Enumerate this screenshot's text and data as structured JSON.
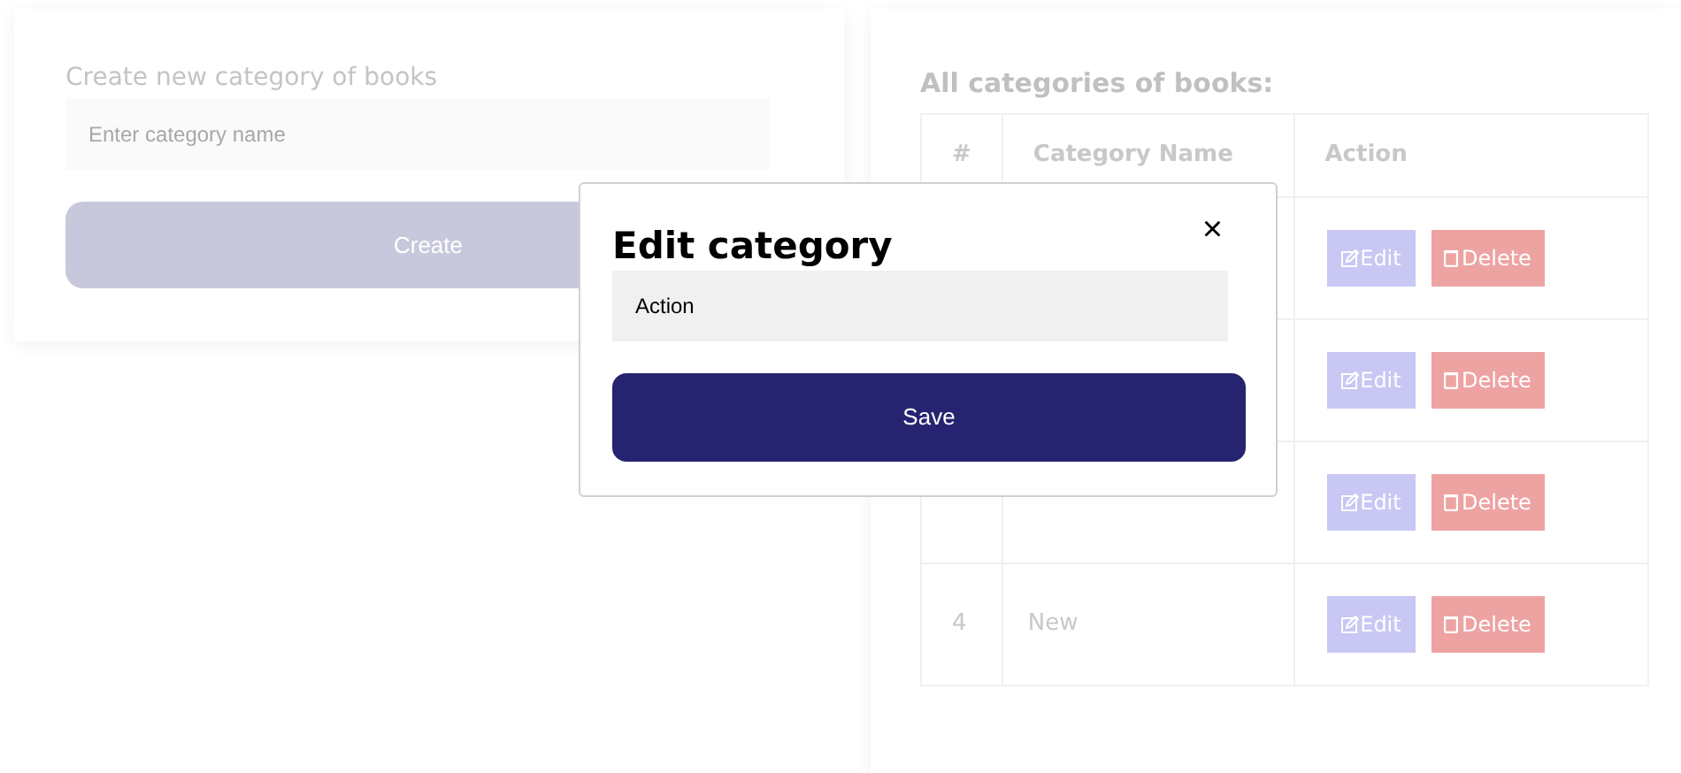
{
  "create_form": {
    "label": "Create new category of books",
    "input": {
      "placeholder": "Enter category name"
    },
    "button": "Create"
  },
  "categories": {
    "title": "All categories of books:",
    "columns": [
      "#",
      "Category Name",
      "Action"
    ],
    "rows": [
      {
        "edit": "Edit",
        "delete": "Delete"
      },
      {
        "edit": "Edit",
        "delete": "Delete"
      },
      {
        "edit": "Edit",
        "delete": "Delete"
      },
      {
        "number": "4",
        "name": "New",
        "edit": "Edit",
        "delete": "Delete"
      }
    ]
  },
  "modal": {
    "title": "Edit category",
    "close": "×",
    "input": {
      "value": "Action"
    },
    "button": "Save"
  }
}
